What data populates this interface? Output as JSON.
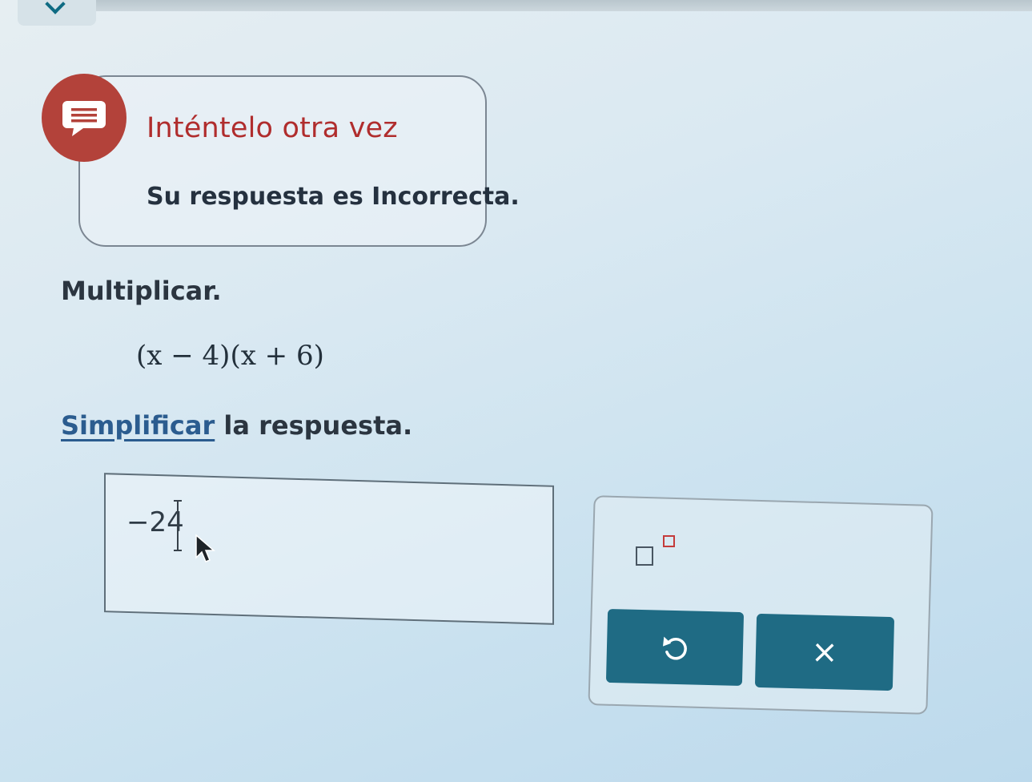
{
  "feedback": {
    "title": "Inténtelo otra vez",
    "message": "Su respuesta es Incorrecta.",
    "icon": "chat-bubble-icon",
    "accent_color": "#b3423a"
  },
  "problem": {
    "instruction": "Multiplicar.",
    "expression": "(x − 4)(x + 6)",
    "directions_link": "Simplificar",
    "directions_rest": " la respuesta."
  },
  "answer": {
    "value": "−24"
  },
  "tools": {
    "exponent_icon": "exponent-template-icon",
    "undo_icon": "undo-icon",
    "clear_icon": "clear-icon",
    "clear_label": "×",
    "button_color": "#1f6b84"
  }
}
